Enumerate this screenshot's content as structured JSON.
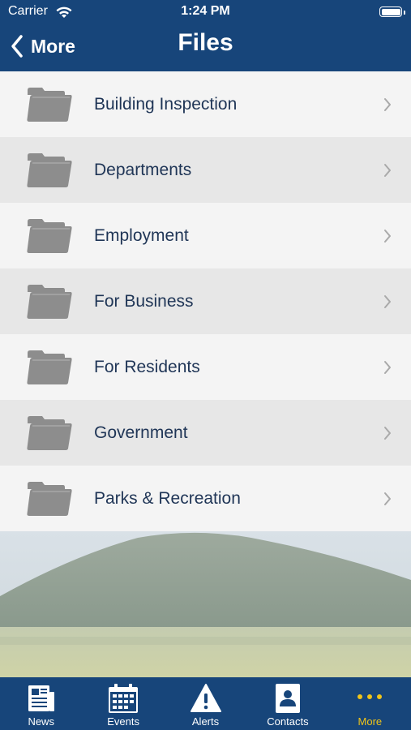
{
  "status_bar": {
    "carrier": "Carrier",
    "time": "1:24 PM"
  },
  "nav": {
    "back_label": "More",
    "title": "Files"
  },
  "files": [
    {
      "label": "Building Inspection"
    },
    {
      "label": "Departments"
    },
    {
      "label": "Employment"
    },
    {
      "label": "For Business"
    },
    {
      "label": "For Residents"
    },
    {
      "label": "Government"
    },
    {
      "label": "Parks & Recreation"
    }
  ],
  "tabs": [
    {
      "label": "News",
      "icon": "newspaper-icon"
    },
    {
      "label": "Events",
      "icon": "calendar-icon"
    },
    {
      "label": "Alerts",
      "icon": "warning-icon"
    },
    {
      "label": "Contacts",
      "icon": "contact-card-icon"
    },
    {
      "label": "More",
      "icon": "more-dots-icon",
      "active": true
    }
  ],
  "colors": {
    "header": "#17457a",
    "accent": "#f0c419",
    "row_light": "#f4f4f4",
    "row_dark": "#e7e7e7",
    "text": "#1f3556"
  }
}
